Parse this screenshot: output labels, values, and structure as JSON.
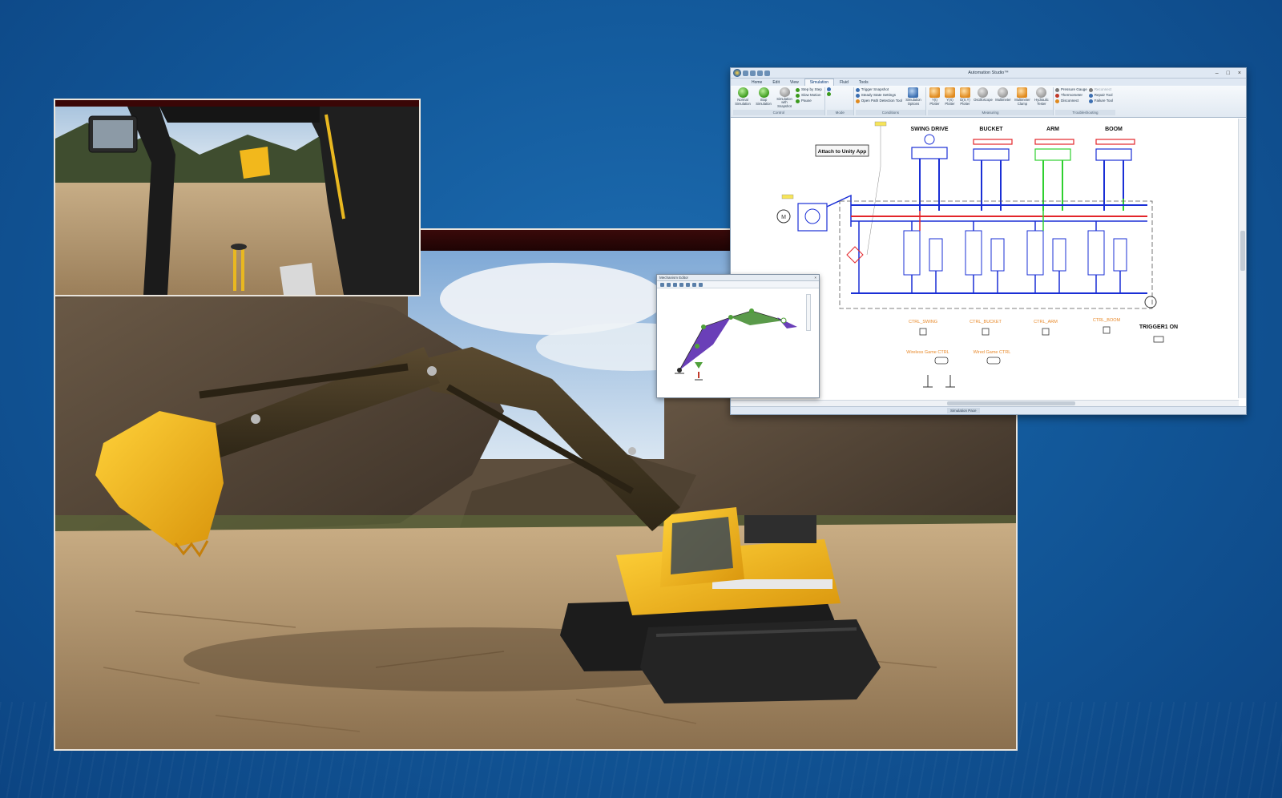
{
  "automation_studio": {
    "window_title": "Automation Studio™",
    "tabs": [
      "Home",
      "Edit",
      "View",
      "Simulation",
      "Fluid",
      "Tools"
    ],
    "active_tab": "Simulation",
    "ribbon": {
      "control": {
        "label": "Control",
        "normal_simulation": "Normal Simulation",
        "stop_simulation": "Stop Simulation",
        "simulation_with_snapshot": "Simulation with Snapshot",
        "step_by_step": "Step by Step",
        "slow_motion": "Slow Motion",
        "pause": "Pause"
      },
      "mode": {
        "label": "Mode"
      },
      "conditions": {
        "label": "Conditions",
        "trigger_snapshot": "Trigger Snapshot",
        "steady_state_settings": "Steady State Settings",
        "open_path_detection_tool": "Open Path Detection Tool",
        "simulation_options": "Simulation Options"
      },
      "measuring": {
        "label": "Measuring",
        "y_t_plotter": "Y(t) Plotter",
        "y_x_plotter": "Y(X) Plotter",
        "dxy_plotter": "D(X,Y) Plotter",
        "oscilloscope": "Oscilloscope",
        "multimeter": "Multimeter",
        "multimeter_clamp": "Multimeter Clamp",
        "hydraulic_tester": "Hydraulic Tester"
      },
      "troubleshooting": {
        "label": "Troubleshooting",
        "pressure_gauge": "Pressure Gauge",
        "thermometer": "Thermometer",
        "disconnect": "Disconnect",
        "reconnect": "Reconnect",
        "repair_tool": "Repair Tool",
        "failure_tool": "Failure Tool"
      }
    },
    "schematic": {
      "attach_button": "Attach to Unity App",
      "sections": [
        "SWING DRIVE",
        "BUCKET",
        "ARM",
        "BOOM"
      ],
      "controls": [
        "CTRL_SWING",
        "CTRL_BUCKET",
        "CTRL_ARM",
        "CTRL_BOOM"
      ],
      "trigger": "TRIGGER1 ON",
      "wireless": "Wireless Game CTRL",
      "wired": "Wired Game CTRL"
    },
    "status": {
      "simulation_pace": "Simulation Pace"
    }
  },
  "mechanism_window": {
    "title": "Mechanism Editor"
  },
  "colors": {
    "background": "#135a9c",
    "machine_yellow": "#f2b81c",
    "hydraulic_blue": "#1a2fd6",
    "hydraulic_red": "#e3252a",
    "hydraulic_green": "#2fd02f",
    "orange_label": "#e8892a",
    "mech_purple": "#6a3fb8",
    "mech_green": "#5a9a4a"
  }
}
